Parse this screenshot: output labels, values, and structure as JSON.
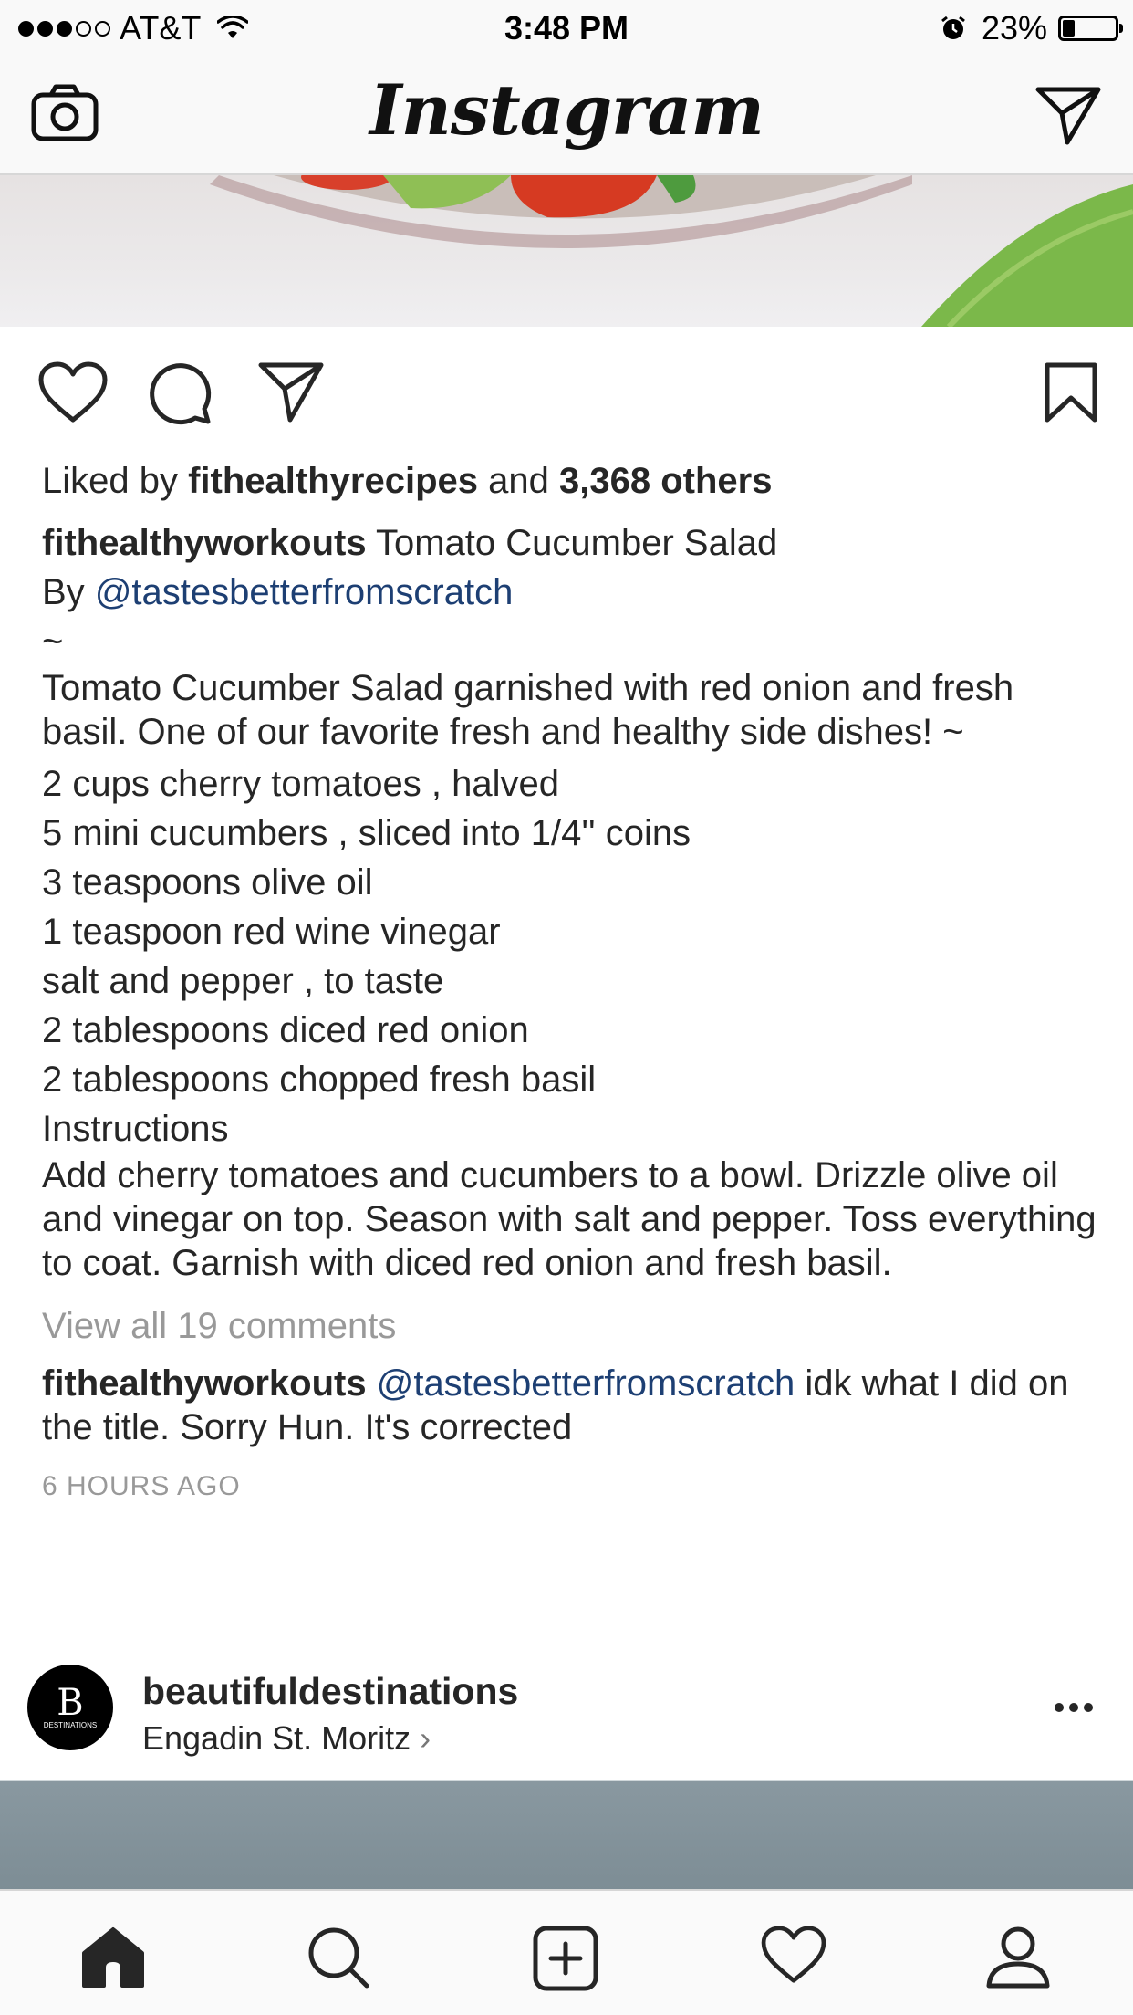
{
  "status_bar": {
    "carrier": "AT&T",
    "time": "3:48 PM",
    "battery_percent": "23%",
    "signal_bars_filled": 3,
    "signal_bars_total": 5,
    "icons": [
      "wifi-icon",
      "alarm-icon",
      "battery-icon"
    ]
  },
  "header": {
    "logo_text": "Instagram",
    "left_icon": "camera-icon",
    "right_icon": "direct-message-icon"
  },
  "post": {
    "actions": [
      "heart-icon",
      "comment-icon",
      "share-icon",
      "bookmark-icon"
    ],
    "likes": {
      "prefix": "Liked by",
      "user": "fithealthyrecipes",
      "conj": "and",
      "others": "3,368 others"
    },
    "caption": {
      "username": "fithealthyworkouts",
      "title": "Tomato Cucumber Salad",
      "by_prefix": "By",
      "by_handle": "@tastesbetterfromscratch",
      "tilde": "~",
      "description": "Tomato Cucumber Salad garnished with red onion and fresh basil. One of our favorite fresh and healthy side dishes! ~",
      "ingredients": [
        "2  cups cherry tomatoes , halved",
        "5 mini cucumbers , sliced into 1/4'' coins",
        "3  teaspoons olive oil",
        "1 teaspoon  red wine vinegar",
        "salt and pepper , to taste",
        "2 tablespoons diced red onion",
        "2  tablespoons chopped fresh basil"
      ],
      "instructions_heading": "Instructions",
      "instructions": "Add cherry tomatoes and cucumbers to a bowl. Drizzle olive oil and vinegar on top. Season with salt and pepper. Toss everything to coat. Garnish with diced red onion and fresh basil."
    },
    "view_comments": "View all 19 comments",
    "comment": {
      "username": "fithealthyworkouts",
      "mention": "@tastesbetterfromscratch",
      "text": "idk what I did on the title. Sorry Hun. It's corrected"
    },
    "timestamp": "6 HOURS AGO"
  },
  "next_post": {
    "avatar_letter": "B",
    "avatar_caption": "DESTINATIONS",
    "username": "beautifuldestinations",
    "location": "Engadin St. Moritz",
    "location_chevron": "›",
    "menu_icon": "more-options-icon"
  },
  "tab_bar": [
    "home-icon",
    "search-icon",
    "add-post-icon",
    "activity-heart-icon",
    "profile-icon"
  ],
  "colors": {
    "link": "#1d3f73",
    "muted": "#999999",
    "text": "#262626"
  }
}
